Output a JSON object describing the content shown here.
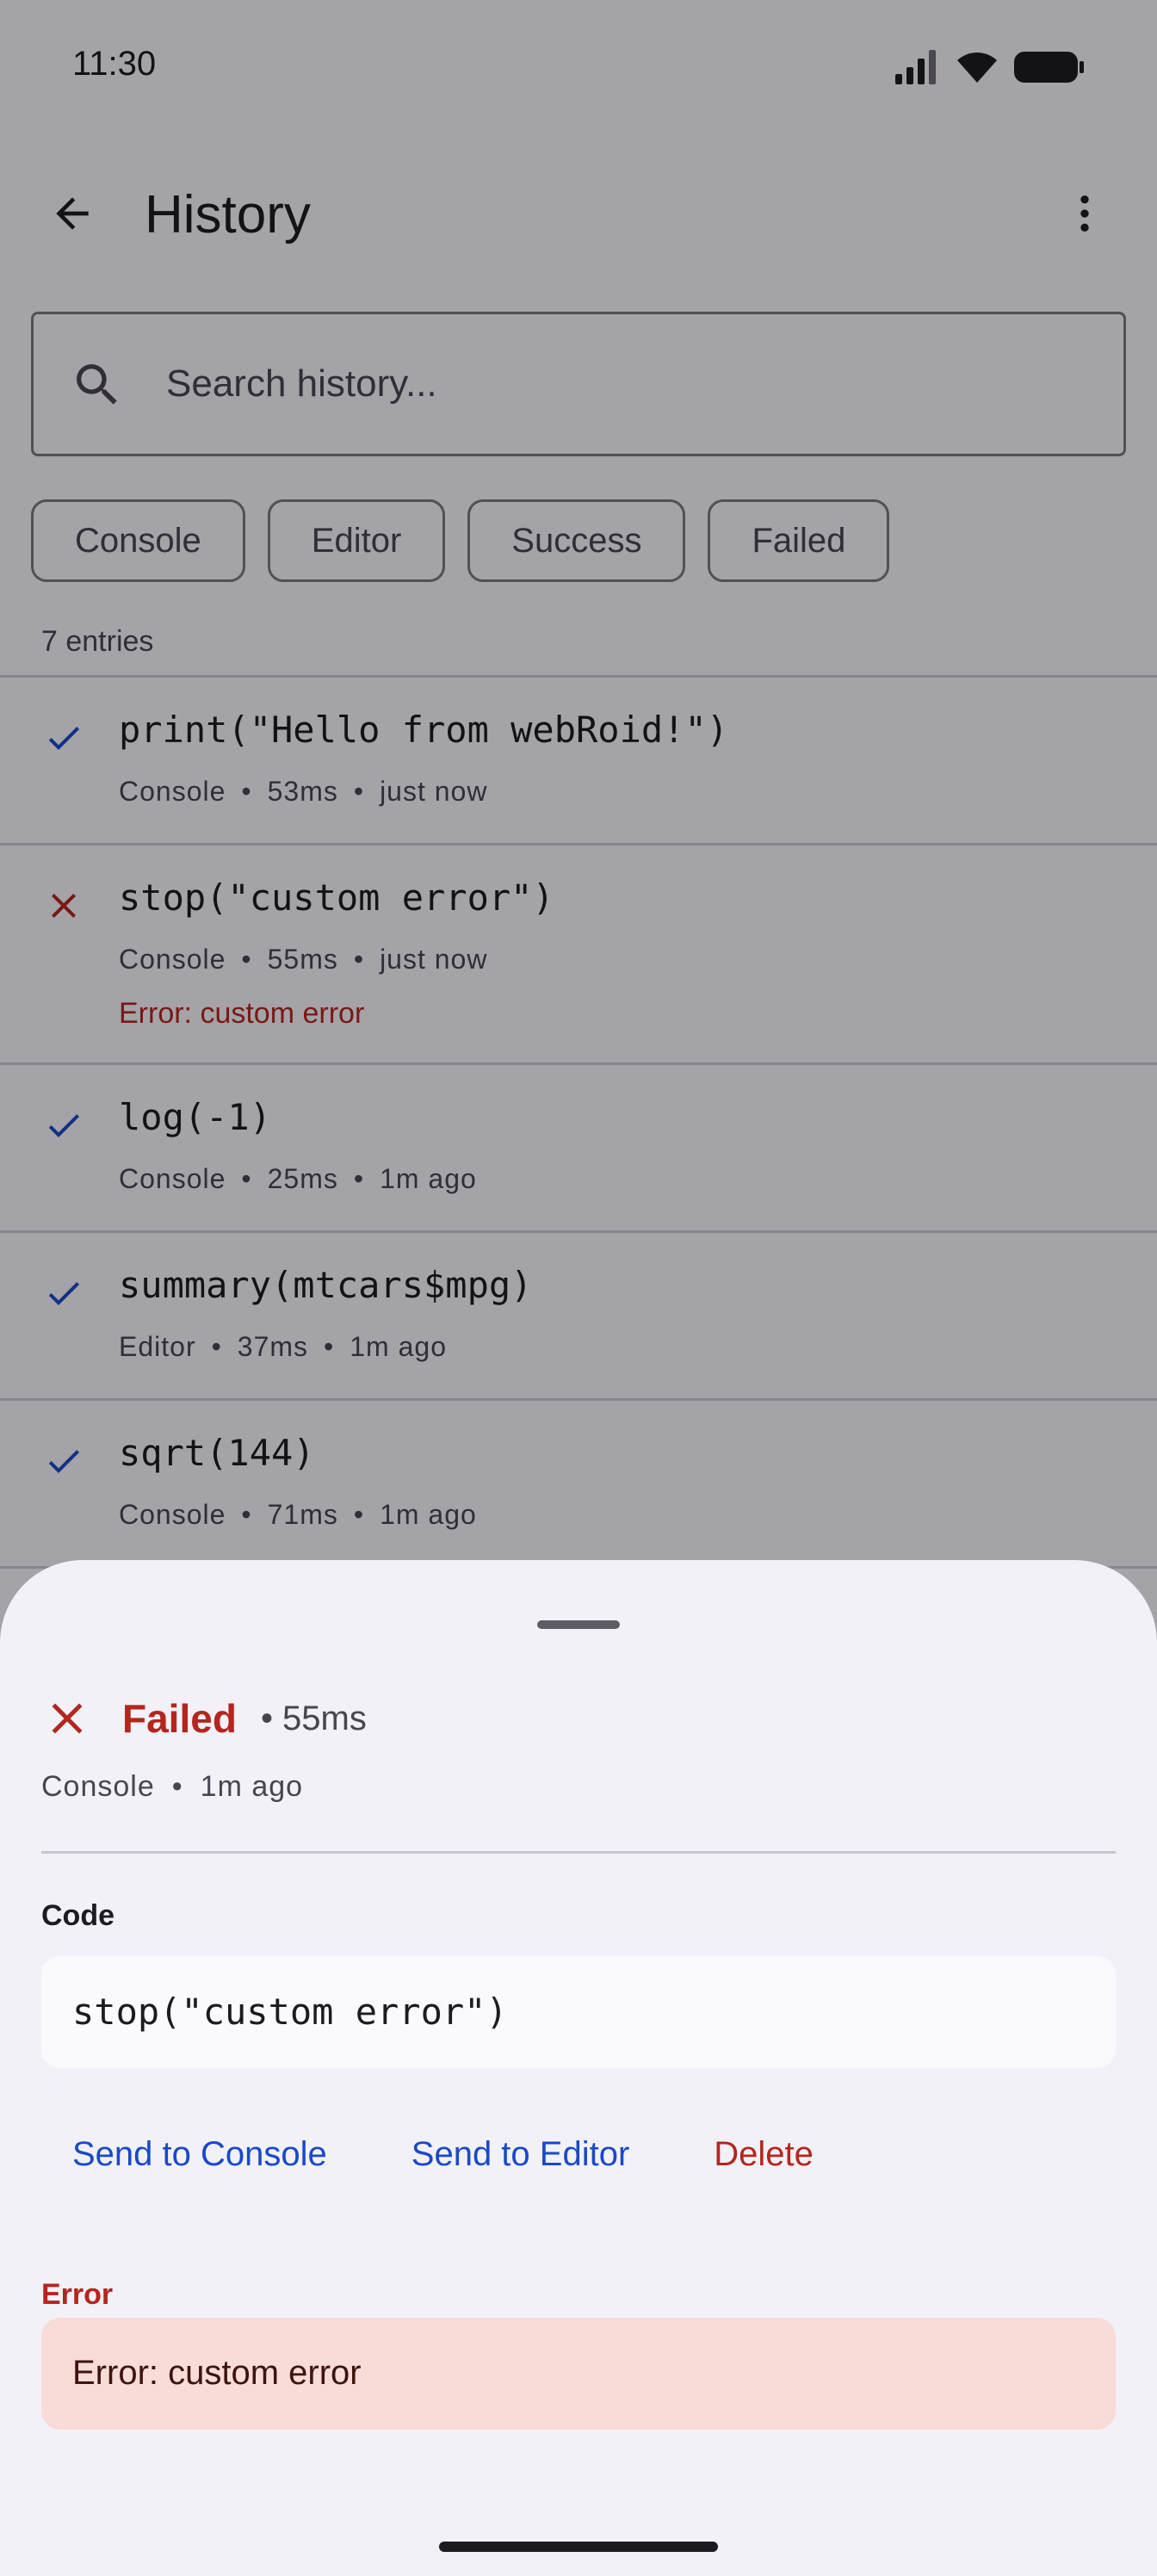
{
  "status_bar": {
    "time": "11:30"
  },
  "header": {
    "title": "History"
  },
  "search": {
    "placeholder": "Search history..."
  },
  "filters": [
    {
      "label": "Console"
    },
    {
      "label": "Editor"
    },
    {
      "label": "Success"
    },
    {
      "label": "Failed"
    }
  ],
  "entry_count": "7 entries",
  "entries": [
    {
      "status": "success",
      "code": "print(\"Hello from webRoid!\")",
      "source": "Console",
      "duration": "53ms",
      "time": "just now",
      "error": ""
    },
    {
      "status": "failed",
      "code": "stop(\"custom error\")",
      "source": "Console",
      "duration": "55ms",
      "time": "just now",
      "error": "Error: custom error"
    },
    {
      "status": "success",
      "code": "log(-1)",
      "source": "Console",
      "duration": "25ms",
      "time": "1m ago",
      "error": ""
    },
    {
      "status": "success",
      "code": "summary(mtcars$mpg)",
      "source": "Editor",
      "duration": "37ms",
      "time": "1m ago",
      "error": ""
    },
    {
      "status": "success",
      "code": "sqrt(144)",
      "source": "Console",
      "duration": "71ms",
      "time": "1m ago",
      "error": ""
    }
  ],
  "sheet": {
    "status_label": "Failed",
    "duration": "• 55ms",
    "source": "Console",
    "time": "1m ago",
    "code_label": "Code",
    "code": "stop(\"custom error\")",
    "actions": {
      "send_console": "Send to Console",
      "send_editor": "Send to Editor",
      "delete": "Delete"
    },
    "error_label": "Error",
    "error_text": "Error: custom error"
  },
  "colors": {
    "success": "#1a49c8",
    "failed": "#b3261e",
    "link": "#1a49c8"
  }
}
